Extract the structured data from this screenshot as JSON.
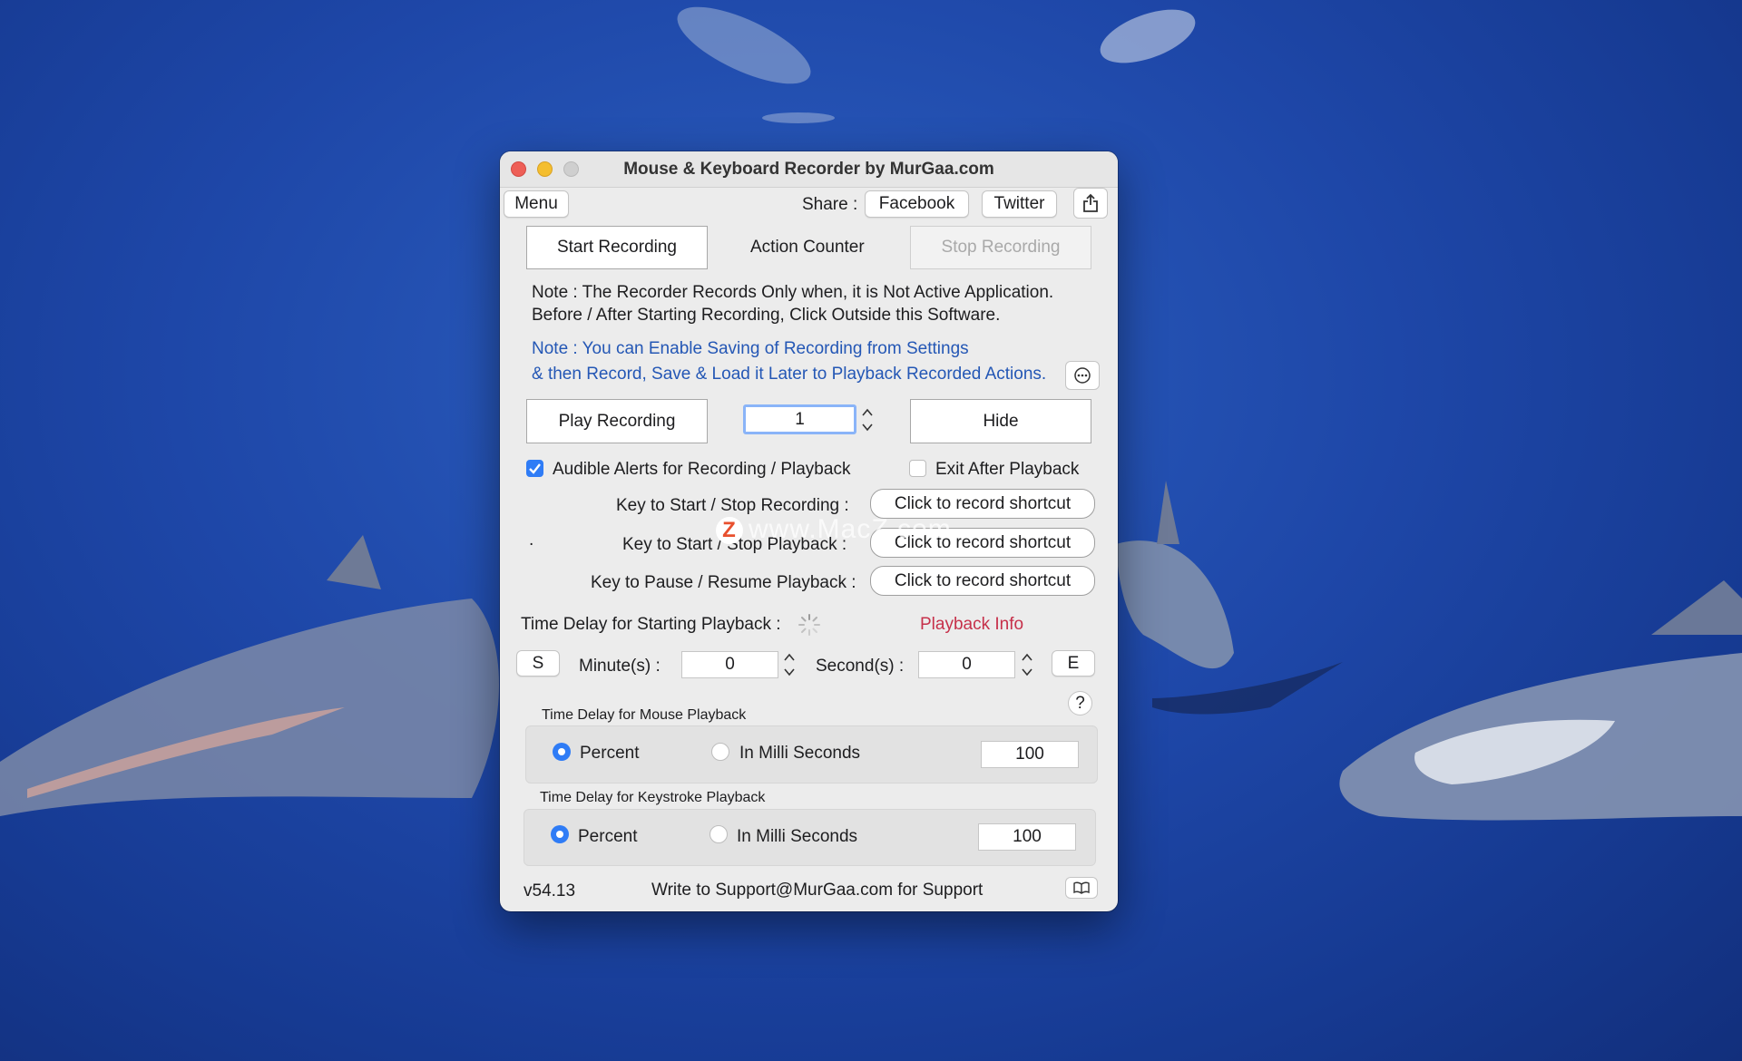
{
  "window": {
    "title": "Mouse & Keyboard Recorder by MurGaa.com"
  },
  "topbar": {
    "menu_label": "Menu",
    "share_label": "Share :",
    "facebook_label": "Facebook",
    "twitter_label": "Twitter"
  },
  "recording": {
    "start_label": "Start Recording",
    "action_counter_label": "Action Counter",
    "stop_label": "Stop Recording"
  },
  "notes": {
    "note1_line1": "Note : The Recorder Records Only when, it is Not Active Application.",
    "note1_line2": "Before / After Starting Recording, Click Outside this Software.",
    "note2_line1": "Note : You can Enable Saving of Recording from Settings",
    "note2_line2": "& then Record, Save & Load it Later to Playback Recorded Actions."
  },
  "playback": {
    "play_label": "Play Recording",
    "count_value": "1",
    "hide_label": "Hide"
  },
  "options": {
    "audible_alerts_label": "Audible Alerts for Recording / Playback",
    "audible_alerts_checked": true,
    "exit_after_label": "Exit After Playback",
    "exit_after_checked": false
  },
  "shortcuts": [
    {
      "label": "Key to Start / Stop Recording :",
      "button": "Click to record shortcut"
    },
    {
      "label": "Key to Start / Stop Playback :",
      "button": "Click to record shortcut"
    },
    {
      "label": "Key to Pause / Resume Playback :",
      "button": "Click to record shortcut"
    }
  ],
  "dot_label": ".",
  "time_delay": {
    "label": "Time Delay for Starting Playback :",
    "info_label": "Playback Info",
    "s_label": "S",
    "minutes_label": "Minute(s) :",
    "minutes_value": "0",
    "seconds_label": "Second(s) :",
    "seconds_value": "0",
    "e_label": "E",
    "help_label": "?"
  },
  "mouse_delay": {
    "title": "Time Delay for Mouse Playback",
    "percent_label": "Percent",
    "ms_label": "In Milli Seconds",
    "selected": "Percent",
    "value": "100"
  },
  "keystroke_delay": {
    "title": "Time Delay for Keystroke Playback",
    "percent_label": "Percent",
    "ms_label": "In Milli Seconds",
    "selected": "Percent",
    "value": "100"
  },
  "footer": {
    "version": "v54.13",
    "support": "Write to Support@MurGaa.com for Support"
  },
  "watermark": "www.MacZ.com",
  "colors": {
    "accent": "#2f7cf6",
    "note_blue": "#2457b5",
    "playback_info_red": "#c6304a"
  },
  "icons": [
    "share-icon",
    "ellipsis-circle-icon",
    "spinner-icon",
    "book-icon"
  ]
}
